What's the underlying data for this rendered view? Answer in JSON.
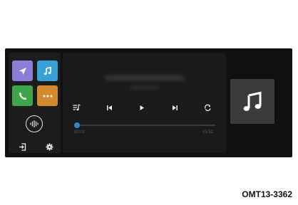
{
  "apps": [
    {
      "name": "maps",
      "icon": "navigation-arrow-icon",
      "color": "#8e7cd9"
    },
    {
      "name": "music",
      "icon": "music-note-icon",
      "color": "#3aa0d8"
    },
    {
      "name": "phone",
      "icon": "phone-icon",
      "color": "#3fa54a"
    },
    {
      "name": "more",
      "icon": "more-dots-icon",
      "color": "#d48a2c"
    }
  ],
  "sidebar_icons": [
    "siri-voice-icon",
    "exit-icon",
    "gear-icon"
  ],
  "now_playing": {
    "title": "———————————",
    "artist": "—————",
    "elapsed": "00:02",
    "total": "03:52",
    "progress": 0.01
  },
  "controls": [
    "queue-icon",
    "previous-track-icon",
    "play-icon",
    "next-track-icon",
    "repeat-icon"
  ],
  "colors": {
    "accent": "#2f86c9",
    "background": "#111111"
  },
  "figure_code": "OMT13-3362"
}
